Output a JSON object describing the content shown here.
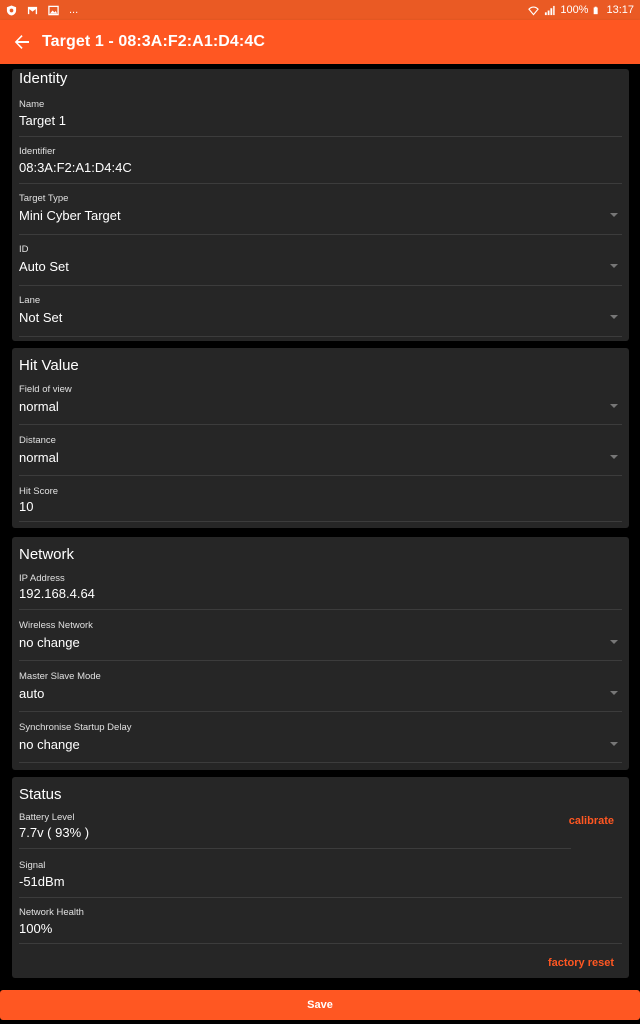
{
  "status_bar": {
    "notifications": [
      "shield-icon",
      "gmail-icon",
      "image-icon"
    ],
    "more": "...",
    "battery": "100%",
    "time": "13:17"
  },
  "app_bar": {
    "title": "Target 1 - 08:3A:F2:A1:D4:4C"
  },
  "identity": {
    "title": "Identity",
    "name_label": "Name",
    "name_value": "Target 1",
    "identifier_label": "Identifier",
    "identifier_value": "08:3A:F2:A1:D4:4C",
    "target_type_label": "Target Type",
    "target_type_value": "Mini Cyber Target",
    "id_label": "ID",
    "id_value": "Auto Set",
    "lane_label": "Lane",
    "lane_value": "Not Set"
  },
  "hit_value": {
    "title": "Hit Value",
    "fov_label": "Field of view",
    "fov_value": "normal",
    "distance_label": "Distance",
    "distance_value": "normal",
    "score_label": "Hit Score",
    "score_value": "10"
  },
  "network": {
    "title": "Network",
    "ip_label": "IP Address",
    "ip_value": "192.168.4.64",
    "wireless_label": "Wireless Network",
    "wireless_value": "no change",
    "msm_label": "Master Slave Mode",
    "msm_value": "auto",
    "sync_label": "Synchronise Startup Delay",
    "sync_value": "no change"
  },
  "status": {
    "title": "Status",
    "battery_label": "Battery Level",
    "battery_value": "7.7v ( 93% )",
    "calibrate": "calibrate",
    "signal_label": "Signal",
    "signal_value": "-51dBm",
    "health_label": "Network Health",
    "health_value": "100%",
    "factory_reset": "factory reset"
  },
  "save_label": "Save",
  "colors": {
    "accent": "#ff5722",
    "card": "#262626",
    "background": "#000000"
  }
}
